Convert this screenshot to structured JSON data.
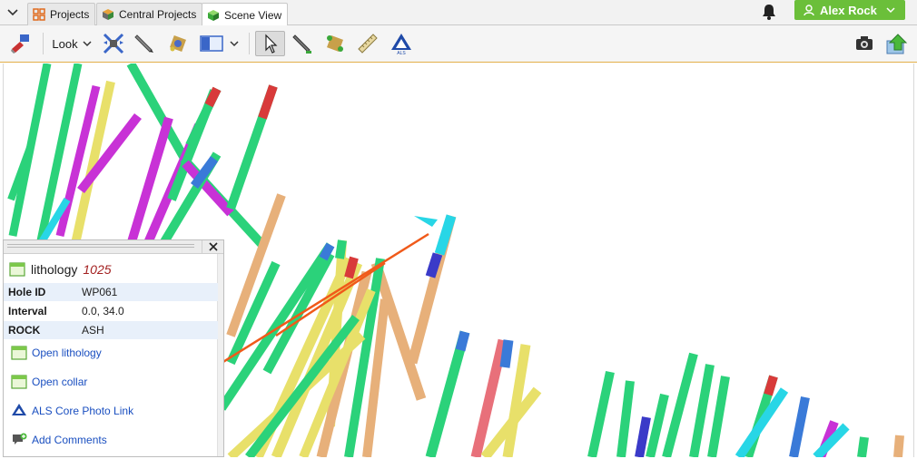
{
  "tabs": [
    {
      "label": "Projects",
      "icon": "projects-icon"
    },
    {
      "label": "Central Projects",
      "icon": "central-projects-icon"
    },
    {
      "label": "Scene View",
      "icon": "scene-view-icon",
      "active": true
    }
  ],
  "user": {
    "name": "Alex Rock",
    "icon": "user-icon"
  },
  "toolbar": {
    "look_label": "Look",
    "icons": [
      "reset-view-icon",
      "look-dropdown",
      "slice-icon",
      "pen-icon",
      "gear-object-icon",
      "layout-icon",
      "select-icon",
      "draw-icon",
      "puzzle-icon",
      "ruler-icon",
      "als-icon",
      "camera-icon",
      "export-icon"
    ]
  },
  "panel": {
    "title": "lithology",
    "title_number": "1025",
    "rows": [
      {
        "key": "Hole ID",
        "value": "WP061"
      },
      {
        "key": "Interval",
        "value": "0.0, 34.0"
      },
      {
        "key": "ROCK",
        "value": "ASH"
      }
    ],
    "links": [
      {
        "label": "Open lithology",
        "icon": "table-icon"
      },
      {
        "label": "Open collar",
        "icon": "table-icon"
      },
      {
        "label": "ALS Core Photo Link",
        "icon": "als-icon"
      },
      {
        "label": "Add Comments",
        "icon": "comment-add-icon"
      }
    ]
  },
  "colors": {
    "accent_green": "#6bbf3a",
    "arrow": "#f05a1a",
    "link": "#1a4fc0",
    "drill_green": "#2bd27a",
    "drill_tan": "#e7b07a",
    "drill_yellow": "#e8e06a",
    "drill_magenta": "#c832d6",
    "drill_blue": "#3a7ad8",
    "drill_red": "#d83a3a",
    "drill_cyan": "#28d6e6"
  }
}
